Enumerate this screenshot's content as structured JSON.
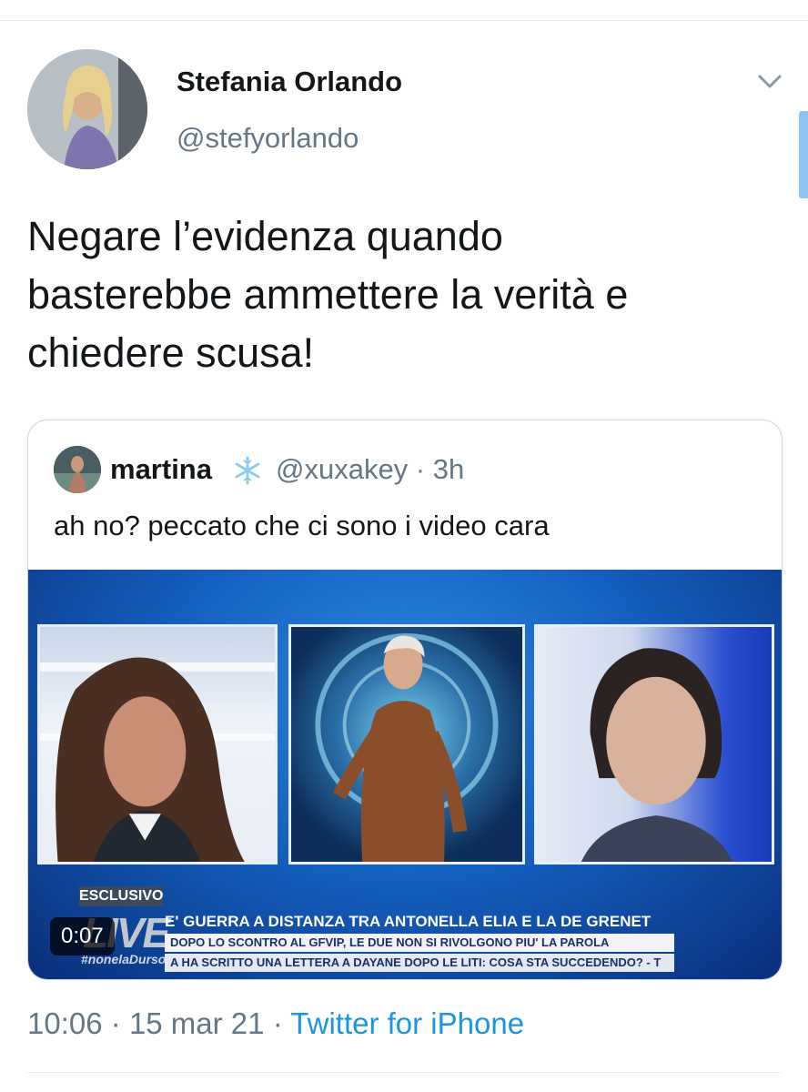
{
  "tweet": {
    "display_name": "Stefania Orlando",
    "handle": "@stefyorlando",
    "text_lines": [
      "Negare l’evidenza quando",
      "basterebbe ammettere la verità e",
      "chiedere scusa!"
    ],
    "time": "10:06",
    "date": "15 mar 21",
    "separator": "·",
    "source": "Twitter for iPhone"
  },
  "quoted": {
    "name": "martina",
    "handle_time": "@xuxakey · 3h",
    "text": "ah no? peccato che ci sono i video cara",
    "video": {
      "duration": "0:07",
      "badge": "ESCLUSIVO",
      "logo": "LIVE",
      "hashtag": "#nonelaDurso",
      "ticker_headline": "E' GUERRA A DISTANZA TRA ANTONELLA ELIA E LA DE GRENET",
      "ticker_line2": "DOPO LO SCONTRO AL GFVIP, LE DUE NON SI RIVOLGONO PIU' LA PAROLA",
      "ticker_line3": "A HA SCRITTO UNA LETTERA A DAYANE DOPO LE LITI: COSA STA SUCCEDENDO? - T"
    }
  },
  "icons": [
    "chevron-down-icon",
    "snowflake-icon"
  ],
  "colors": {
    "link": "#1b95e0",
    "secondary_text": "#657786",
    "border": "#ccd6dd"
  }
}
